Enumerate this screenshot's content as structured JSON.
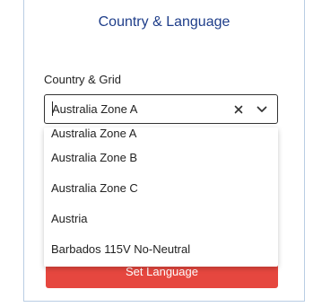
{
  "dialog": {
    "title": "Country & Language",
    "field_label": "Country & Grid",
    "selected_value": "Australia Zone A",
    "submit_label": "Set Language"
  },
  "dropdown": {
    "options": [
      "Australia Zone A",
      "Australia Zone B",
      "Australia Zone C",
      "Austria",
      "Barbados 115V No-Neutral"
    ]
  },
  "icons": {
    "clear": "close-icon",
    "toggle": "chevron-down-icon"
  },
  "colors": {
    "title": "#1f3e8a",
    "accent_button": "#e6473f",
    "card_border": "#b9cde3"
  }
}
